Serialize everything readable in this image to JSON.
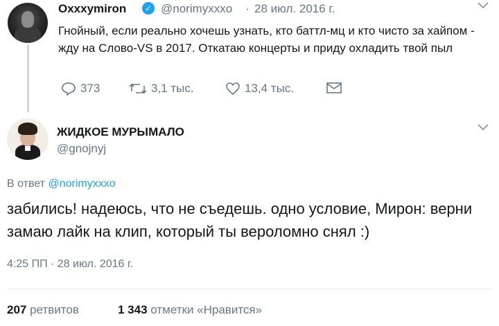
{
  "parent": {
    "name": "Oxxxymiron",
    "handle": "@norimyxxxo",
    "sep": "·",
    "date": "28 июл. 2016 г.",
    "text": "Гнойный, если реально хочешь узнать, кто баттл-мц и кто чисто за хайпом - жду на Слово-VS в 2017. Откатаю концерты и приду охладить твой пыл",
    "replies": "373",
    "retweets": "3,1 тыс.",
    "likes": "13,4 тыс.",
    "verified_glyph": "✓"
  },
  "reply": {
    "name": "ЖИДКОЕ МУРЫМАЛО",
    "handle": "@gnojnyj",
    "in_reply_prefix": "В ответ",
    "in_reply_handle": "@norimyxxxo",
    "text": "забились! надеюсь, что не съедешь. одно условие, Мирон: верни замаю лайк на клип, который ты вероломно снял :)",
    "time": "4:25 ПП · 28 июл. 2016 г."
  },
  "stats": {
    "retweets_count": "207",
    "retweets_label": "ретвитов",
    "likes_count": "1 343",
    "likes_label": "отметки «Нравится»"
  },
  "icons": {
    "chevron": "chevron-down-icon",
    "reply": "reply-icon",
    "retweet": "retweet-icon",
    "like": "heart-icon",
    "dm": "mail-icon"
  },
  "colors": {
    "accent": "#1da1f2",
    "muted": "#657786",
    "text": "#14171a"
  }
}
